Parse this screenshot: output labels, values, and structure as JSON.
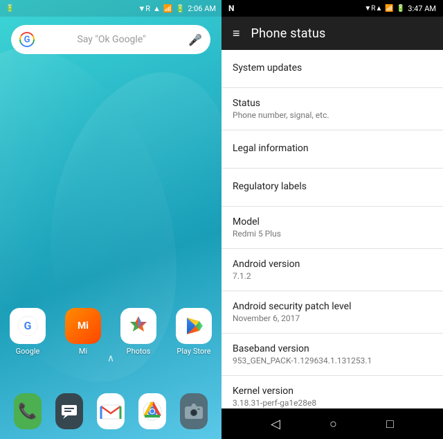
{
  "left": {
    "status_bar": {
      "time": "2:06 AM",
      "icons": [
        "R",
        "signal",
        "battery"
      ]
    },
    "search": {
      "placeholder": "Say \"Ok Google\""
    },
    "apps": [
      {
        "label": "Google",
        "icon_type": "google"
      },
      {
        "label": "Mi",
        "icon_type": "mi"
      },
      {
        "label": "Photos",
        "icon_type": "photos"
      },
      {
        "label": "Play Store",
        "icon_type": "playstore"
      }
    ],
    "dock": [
      {
        "label": "Phone",
        "icon_type": "phone"
      },
      {
        "label": "Messages",
        "icon_type": "messages"
      },
      {
        "label": "Gmail",
        "icon_type": "gmail"
      },
      {
        "label": "Chrome",
        "icon_type": "chrome"
      },
      {
        "label": "Camera",
        "icon_type": "camera"
      }
    ]
  },
  "right": {
    "status_bar": {
      "time": "3:47 AM",
      "left_icon": "N"
    },
    "header": {
      "title": "Phone status",
      "menu_icon": "≡"
    },
    "settings_items": [
      {
        "title": "System updates",
        "subtitle": null
      },
      {
        "title": "Status",
        "subtitle": "Phone number, signal, etc."
      },
      {
        "title": "Legal information",
        "subtitle": null
      },
      {
        "title": "Regulatory labels",
        "subtitle": null
      },
      {
        "title": "Model",
        "subtitle": "Redmi 5 Plus"
      },
      {
        "title": "Android version",
        "subtitle": "7.1.2"
      },
      {
        "title": "Android security patch level",
        "subtitle": "November 6, 2017"
      },
      {
        "title": "Baseband version",
        "subtitle": "953_GEN_PACK-1.129634.1.131253.1"
      },
      {
        "title": "Kernel version",
        "subtitle": "3.18.31-perf-ga1e28e8"
      }
    ],
    "nav": {
      "back": "◁",
      "home": "○",
      "recents": "□"
    }
  }
}
